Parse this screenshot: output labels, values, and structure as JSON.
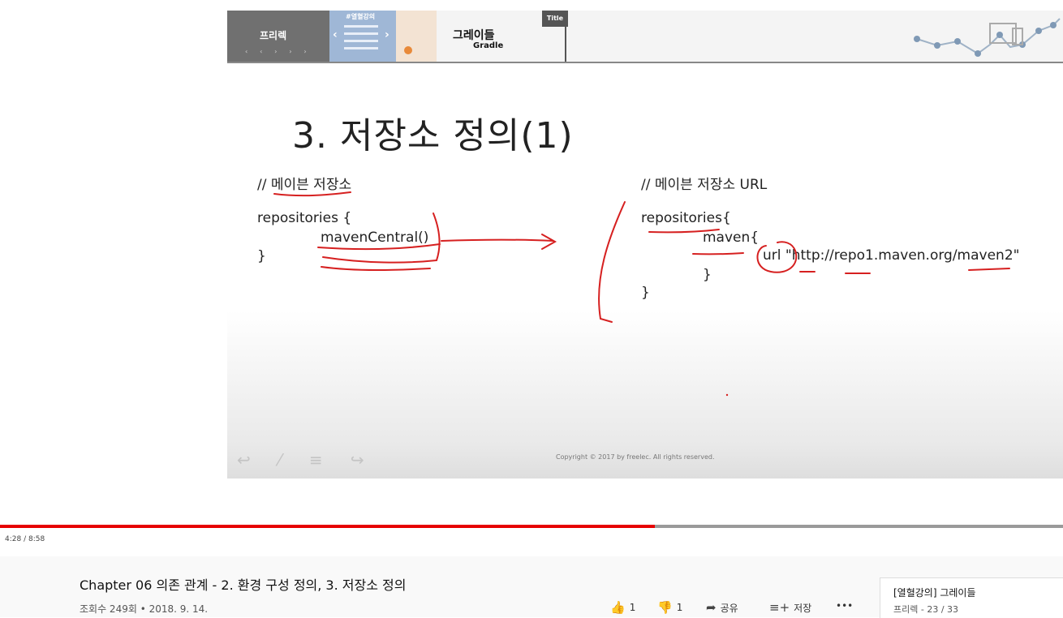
{
  "slide": {
    "channel_name": "프리렉",
    "promo_tag": "#열혈강의",
    "course_title_kr": "그레이들",
    "course_title_en": "Gradle",
    "title_tag": "Title",
    "heading": "3. 저장소 정의(1)",
    "left_comment": "// 메이븐 저장소",
    "left_code": [
      "repositories {",
      "mavenCentral()",
      "}"
    ],
    "right_comment": "// 메이븐 저장소 URL",
    "right_code": [
      "repositories{",
      "maven{",
      "url \"http://repo1.maven.org/maven2\"",
      "}",
      "}"
    ],
    "copyright": "Copyright © 2017 by freelec. All rights reserved."
  },
  "player": {
    "progress": 0.616,
    "time": "4:28 / 8:58",
    "accent": "#e60000"
  },
  "video": {
    "title": "Chapter 06 의존 관계 - 2. 환경 구성 정의, 3. 저장소 정의",
    "meta": "조회수 249회 • 2018. 9. 14.",
    "likes": "1",
    "dislikes": "1",
    "share_label": "공유",
    "save_label": "저장",
    "more_label": "•••",
    "icons": {
      "like": "thumbs-up-icon",
      "dislike": "thumbs-down-icon",
      "share": "share-icon",
      "save": "playlist-add-icon"
    }
  },
  "playlist": {
    "title": "[열혈강의] 그레이들",
    "subtitle": "프리렉 - 23 / 33"
  }
}
